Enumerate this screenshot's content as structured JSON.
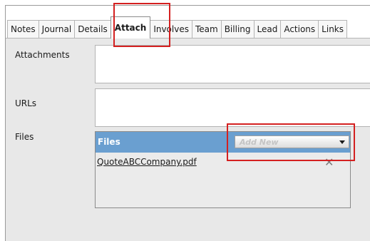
{
  "tabs": [
    "Notes",
    "Journal",
    "Details",
    "Attach",
    "Involves",
    "Team",
    "Billing",
    "Lead",
    "Actions",
    "Links"
  ],
  "active_tab": "Attach",
  "fields": {
    "attachments_label": "Attachments",
    "urls_label": "URLs",
    "files_label": "Files"
  },
  "files_panel": {
    "title": "Files",
    "add_new_placeholder": "Add New",
    "items": [
      {
        "name": "QuoteABCCompany.pdf"
      }
    ]
  },
  "colors": {
    "files_header": "#6a9fd0",
    "highlight": "#d42020",
    "content_bg": "#e8e8e8"
  },
  "icons": {
    "dropdown": "chevron-down-icon",
    "remove": "close-icon"
  }
}
